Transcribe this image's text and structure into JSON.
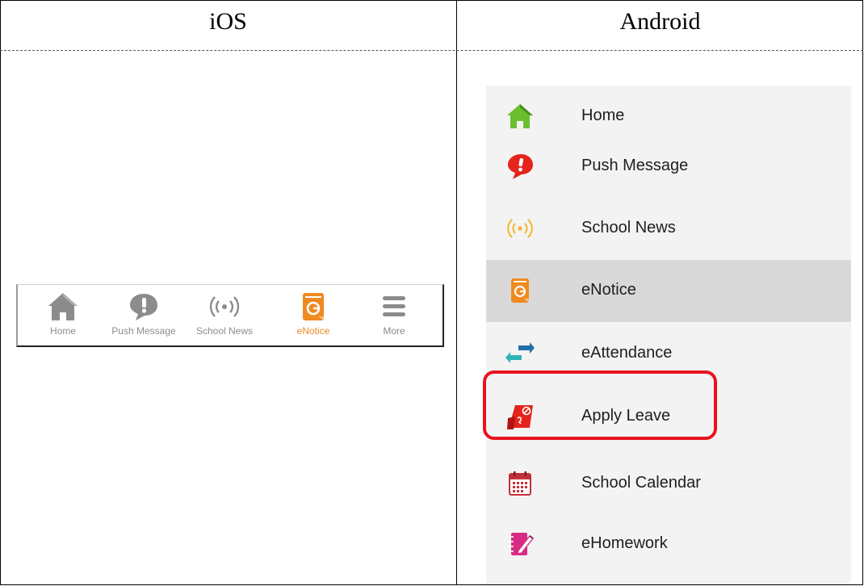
{
  "headers": {
    "ios": "iOS",
    "android": "Android"
  },
  "ios_tabbar": {
    "tabs": [
      {
        "label": "Home",
        "icon": "home-icon"
      },
      {
        "label": "Push Message",
        "icon": "push-message-icon"
      },
      {
        "label": "School News",
        "icon": "school-news-icon"
      },
      {
        "label": "eNotice",
        "icon": "enotice-icon",
        "active": true
      },
      {
        "label": "More",
        "icon": "more-icon"
      }
    ],
    "colors": {
      "inactive": "#8c8c8c",
      "active": "#ef8a1f"
    }
  },
  "android_drawer": {
    "items": [
      {
        "label": "Home",
        "icon": "home-icon"
      },
      {
        "label": "Push Message",
        "icon": "push-message-icon"
      },
      {
        "label": "School News",
        "icon": "school-news-icon"
      },
      {
        "label": "eNotice",
        "icon": "enotice-icon",
        "selected": true
      },
      {
        "label": "eAttendance",
        "icon": "eattendance-icon"
      },
      {
        "label": "Apply Leave",
        "icon": "apply-leave-icon",
        "highlighted": true
      },
      {
        "label": "School Calendar",
        "icon": "school-calendar-icon"
      },
      {
        "label": "eHomework",
        "icon": "ehomework-icon"
      }
    ],
    "colors": {
      "highlight": "#e8141c",
      "selected_bg": "#d9d9d9"
    }
  }
}
